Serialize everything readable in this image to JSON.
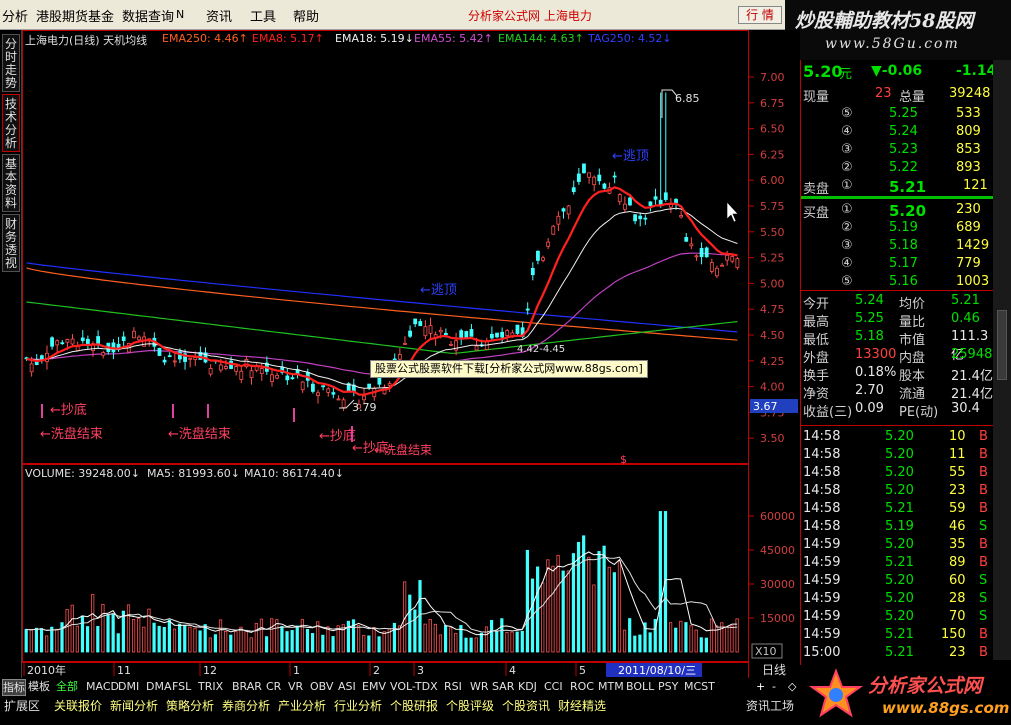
{
  "menu": {
    "items": [
      "分析",
      "港股期货基金",
      "数据查询",
      "资讯",
      "工具",
      "帮助"
    ],
    "menu_glyph": "N",
    "center_title": "分析家公式网  上海电力",
    "quote_button": "行 情",
    "min_button": "—",
    "close_button": "×"
  },
  "brand": {
    "line1": "炒股輔助教材58股网",
    "line2": "www.58Gu.com"
  },
  "side_tabs": [
    "分时走势",
    "技术分析",
    "基本资料",
    "财务透视"
  ],
  "chart_header": {
    "name": "上海电力(日线) 天机均线",
    "ema250": "EMA250: 4.46↑",
    "ema8": "EMA8: 5.17↑",
    "ema18": "EMA18: 5.19↓",
    "ema55": "EMA55: 5.42↑",
    "ema144": "EMA144: 4.63↑",
    "last": "TAG250: 4.52↓"
  },
  "price_axis": [
    "7.00",
    "6.75",
    "6.50",
    "6.25",
    "6.00",
    "5.75",
    "5.50",
    "5.25",
    "5.00",
    "4.75",
    "4.50",
    "4.25",
    "4.00",
    "3.75",
    "3.50"
  ],
  "current_price_tag": "3.67",
  "annotations": {
    "high": "6.85",
    "low": "3.79",
    "range": "4.42-4.45",
    "escape1": "←逃顶",
    "escape2": "←逃顶",
    "bottom1": "←抄底",
    "wash1": "←洗盘结束",
    "wash2": "←洗盘结束",
    "bottom2": "←抄底",
    "bottom3": "←抄底",
    "wash3": "←洗盘结束",
    "dollar": "$"
  },
  "popup": "股票公式股票软件下载[分析家公式网www.88gs.com]",
  "volume_header": {
    "volume": "VOLUME: 39248.00↓",
    "ma5": "MA5: 81993.60↓",
    "ma10": "MA10: 86174.40↓"
  },
  "volume_axis": [
    "60000",
    "45000",
    "30000",
    "15000"
  ],
  "volume_unit": "X10",
  "time_axis": [
    "2010年",
    "11",
    "12",
    "1",
    "2",
    "3",
    "4",
    "5"
  ],
  "time_cursor": "2011/08/10/三",
  "period_label": "日线",
  "quote": {
    "price": "5.20",
    "price_unit": "元",
    "change": "▼-0.06",
    "change_pct": "-1.14",
    "now_vol_label": "现量",
    "now_vol": "23",
    "total_vol_label": "总量",
    "total_vol": "39248",
    "sell_label": "卖盘",
    "buy_label": "买盘",
    "sells": [
      {
        "lv": "⑤",
        "p": "5.25",
        "v": "533"
      },
      {
        "lv": "④",
        "p": "5.24",
        "v": "809"
      },
      {
        "lv": "③",
        "p": "5.23",
        "v": "853"
      },
      {
        "lv": "②",
        "p": "5.22",
        "v": "893"
      },
      {
        "lv": "①",
        "p": "5.21",
        "v": "121"
      }
    ],
    "buys": [
      {
        "lv": "①",
        "p": "5.20",
        "v": "230"
      },
      {
        "lv": "②",
        "p": "5.19",
        "v": "689"
      },
      {
        "lv": "③",
        "p": "5.18",
        "v": "1429"
      },
      {
        "lv": "④",
        "p": "5.17",
        "v": "779"
      },
      {
        "lv": "⑤",
        "p": "5.16",
        "v": "1003"
      }
    ],
    "stats": [
      {
        "l1": "今开",
        "v1": "5.24",
        "l2": "均价",
        "v2": "5.21"
      },
      {
        "l1": "最高",
        "v1": "5.25",
        "l2": "量比",
        "v2": "0.46"
      },
      {
        "l1": "最低",
        "v1": "5.18",
        "l2": "市值",
        "v2": "111.3亿"
      },
      {
        "l1": "外盘",
        "v1": "13300",
        "l2": "内盘",
        "v2": "25948"
      },
      {
        "l1": "换手",
        "v1": "0.18%",
        "l2": "股本",
        "v2": "21.4亿"
      },
      {
        "l1": "净资",
        "v1": "2.70",
        "l2": "流通",
        "v2": "21.4亿"
      },
      {
        "l1": "收益(三)",
        "v1": "0.09",
        "l2": "PE(动)",
        "v2": "30.4"
      }
    ],
    "ticks": [
      {
        "t": "14:58",
        "p": "5.20",
        "v": "10",
        "d": "B"
      },
      {
        "t": "14:58",
        "p": "5.20",
        "v": "11",
        "d": "B"
      },
      {
        "t": "14:58",
        "p": "5.20",
        "v": "55",
        "d": "B"
      },
      {
        "t": "14:58",
        "p": "5.20",
        "v": "23",
        "d": "B"
      },
      {
        "t": "14:58",
        "p": "5.21",
        "v": "59",
        "d": "B"
      },
      {
        "t": "14:58",
        "p": "5.19",
        "v": "46",
        "d": "S"
      },
      {
        "t": "14:59",
        "p": "5.20",
        "v": "35",
        "d": "B"
      },
      {
        "t": "14:59",
        "p": "5.21",
        "v": "89",
        "d": "B"
      },
      {
        "t": "14:59",
        "p": "5.20",
        "v": "60",
        "d": "S"
      },
      {
        "t": "14:59",
        "p": "5.20",
        "v": "28",
        "d": "S"
      },
      {
        "t": "14:59",
        "p": "5.20",
        "v": "70",
        "d": "S"
      },
      {
        "t": "14:59",
        "p": "5.21",
        "v": "150",
        "d": "B"
      },
      {
        "t": "15:00",
        "p": "5.21",
        "v": "23",
        "d": "B"
      }
    ]
  },
  "indicator_tabs": [
    "指标",
    "模板",
    "全部",
    "MACD",
    "DMI",
    "DMA",
    "FSL",
    "TRIX",
    "BRAR",
    "CR",
    "VR",
    "OBV",
    "ASI",
    "EMV",
    "VOL-TDX",
    "RSI",
    "WR",
    "SAR",
    "KDJ",
    "CCI",
    "ROC",
    "MTM",
    "BOLL",
    "PSY",
    "MCST"
  ],
  "nav_controls": [
    "+",
    "-",
    "◇"
  ],
  "bottom_tabs": [
    "扩展区",
    "关联报价",
    "新闻分析",
    "策略分析",
    "券商分析",
    "产业分析",
    "行业分析",
    "个股研报",
    "个股评级",
    "个股资讯",
    "财经精选"
  ],
  "bottom_right": "资讯工场",
  "logo": {
    "title": "分析家公式网",
    "url": "www.88gs.com"
  },
  "colors": {
    "up": "#ff3030",
    "down": "#00e000",
    "ema8": "#ff2020",
    "ema18": "#f0f0f0",
    "ema55": "#c040c0",
    "ema144": "#20c020",
    "ema250": "#ff6020",
    "tag250": "#2030ff"
  }
}
